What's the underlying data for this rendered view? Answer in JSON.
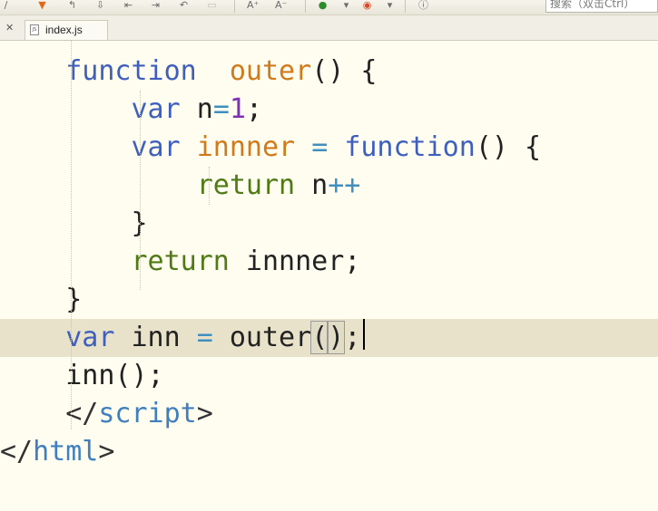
{
  "toolbar": {
    "icons": [
      "bookmark-icon",
      "prev-file-icon",
      "next-file-icon",
      "go-first-icon",
      "go-last-icon",
      "undo-icon",
      "disabled-icon",
      "font-increase-icon",
      "font-decrease-icon",
      "run-icon",
      "dropdown-icon",
      "browser-icon",
      "dropdown-icon",
      "info-icon"
    ],
    "search_placeholder": "搜索（双击Ctrl）"
  },
  "tabs": [
    {
      "label": "index.js",
      "active": true
    }
  ],
  "code": {
    "lines": [
      {
        "indent": "    ",
        "tokens": [
          [
            "kw",
            "function"
          ],
          [
            "",
            "  "
          ],
          [
            "fn",
            "outer"
          ],
          [
            "",
            "() {"
          ]
        ]
      },
      {
        "indent": "        ",
        "tokens": [
          [
            "kw",
            "var"
          ],
          [
            "",
            " n"
          ],
          [
            "op",
            "="
          ],
          [
            "num",
            "1"
          ],
          [
            "",
            ";"
          ]
        ]
      },
      {
        "indent": "        ",
        "tokens": [
          [
            "kw",
            "var"
          ],
          [
            "",
            " "
          ],
          [
            "fn",
            "innner"
          ],
          [
            "",
            " "
          ],
          [
            "op",
            "="
          ],
          [
            "",
            " "
          ],
          [
            "kw",
            "function"
          ],
          [
            "",
            "() {"
          ]
        ]
      },
      {
        "indent": "            ",
        "tokens": [
          [
            "kw-green",
            "return"
          ],
          [
            "",
            " n"
          ],
          [
            "op",
            "++"
          ]
        ]
      },
      {
        "indent": "        ",
        "tokens": [
          [
            "",
            "}"
          ]
        ]
      },
      {
        "indent": "        ",
        "tokens": [
          [
            "kw-green",
            "return"
          ],
          [
            "",
            " innner;"
          ]
        ]
      },
      {
        "indent": "    ",
        "tokens": [
          [
            "",
            "}"
          ]
        ]
      },
      {
        "indent": "    ",
        "tokens": [
          [
            "kw",
            "var"
          ],
          [
            "",
            " inn "
          ],
          [
            "op",
            "="
          ],
          [
            "",
            " outer"
          ],
          [
            "paren",
            "()"
          ],
          [
            "",
            ";"
          ]
        ],
        "current": true
      },
      {
        "indent": "    ",
        "tokens": [
          [
            "",
            "inn();"
          ]
        ]
      },
      {
        "indent": "    ",
        "tokens": [
          [
            "tag",
            "</"
          ],
          [
            "tagname",
            "script"
          ],
          [
            "tag",
            ">"
          ]
        ]
      },
      {
        "indent": "",
        "tokens": [
          [
            "tag",
            "</"
          ],
          [
            "tagname",
            "html"
          ],
          [
            "tag",
            ">"
          ]
        ]
      }
    ]
  }
}
